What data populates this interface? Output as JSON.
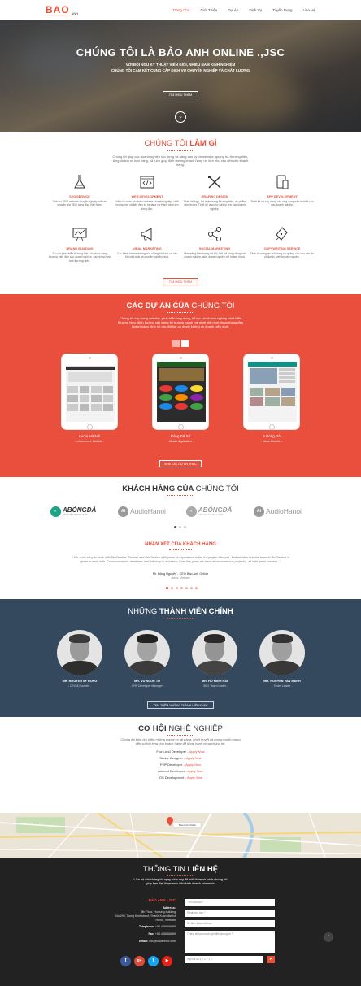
{
  "header": {
    "logo": "BAO",
    "logo_suffix": "ANH",
    "nav": [
      "Trang Chủ",
      "Giới Thiệu",
      "Dự Án",
      "Dịch Vụ",
      "Tuyển Dụng",
      "Liên Hệ"
    ]
  },
  "hero": {
    "title": "CHÚNG TÔI LÀ BẢO ANH ONLINE .,JSC",
    "line1": "VỚI ĐỘI NGŨ KỸ THUẬT VIÊN GIỎI, NHIỀU NĂM KINH NGHIỆM",
    "line2": "CHÚNG TÔI CAM KẾT CUNG CẤP DỊCH VỤ CHUYÊN NGHIỆP VÀ CHẤT LƯỢNG",
    "button": "TÌM HIỂU THÊM"
  },
  "services": {
    "title_a": "CHÚNG TÔI ",
    "title_b": "LÀM GÌ",
    "desc": "Chúng tôi giúp các doanh nghiệp tạo dựng và nâng cao uy tín website, quảng bá thương hiệu, tăng doanh số bán hàng, và luôn giúp định hướng khách hàng ưu tiên nhu cầu đến cho khách hàng.",
    "items": [
      {
        "name": "SEO SERVICE",
        "desc": "Dịch vụ SEO website chuyên nghiệp với các chuyên gia SEO hàng đầu Việt Nam.",
        "icon": "flask-icon"
      },
      {
        "name": "WEB DEVELOPMENT",
        "desc": "Web lôi cuốn và nhiều website chuyên nghiệp, chất lượng mới và tiên đến từ hạ tầng và thành tầng lớn từng đầu.",
        "icon": "code-icon"
      },
      {
        "name": "GRAPHIC DESIGN",
        "desc": "Thiết kế logo, bộ nhận dạng thương hiệu, ấn phẩm văn phòng. Thiết kế chuyên nghiệp cho các doanh nghiệp.",
        "icon": "pen-ruler-icon"
      },
      {
        "name": "APP DEVELOPMENT",
        "desc": "Thiết kế và xây dựng các ứng dụng trên mobile cho các doanh nghiệp.",
        "icon": "devices-icon"
      },
      {
        "name": "BRAND BUILDING",
        "desc": "Tư vấn phát triển thương hiệu, từ nhận dạng thương hiệu đến các doanh nghiệp, xây dựng hình ảnh thương hiệu.",
        "icon": "chart-board-icon"
      },
      {
        "name": "VIRAL MARKETING",
        "desc": "Các kênh fanmarketing của chúng tôi luôn có các bài viết chất và chuyên nghiệp nhất.",
        "icon": "megaphone-icon"
      },
      {
        "name": "SOCIAL MARKETING",
        "desc": "Marketing trên mạng xã hội, kết nối công đồng với doanh nghiệp, giúp doanh nghiệp với khách hàng.",
        "icon": "share-icon"
      },
      {
        "name": "COPYWRITING SERVICE",
        "desc": "Dịch vụ sáng tạo nội dung và quảng cáo cho các ấn phẩm in, viết chuyên nghiệp.",
        "icon": "fountain-pen-icon"
      }
    ],
    "button": "TÌM HIỂU THÊM"
  },
  "projects": {
    "title_a": "CÁC DỰ ÁN CỦA ",
    "title_b": "CHÚNG TÔI",
    "desc": "Chúng tôi xây dựng website, phát triển ứng dụng, hỗ trợ các doanh nghiệp phát triển thương hiệu, định hướng cấu trúng thị trường mạnh mẽ nhất hiện thời được thông đến khách hàng, ủng hộ các đối tác và duyệt không có doanh hiểu nhất.",
    "items": [
      {
        "name": "Audio Hà Nội",
        "type": "- eCommerce Website -"
      },
      {
        "name": "Bóng Đá Số",
        "type": "- Mobile Application -"
      },
      {
        "name": "A Bóng Đá",
        "type": "- News Website -"
      }
    ],
    "button": "XEM CÁC DỰ ÁN KHÁC"
  },
  "clients": {
    "title_a": "KHÁCH HÀNG CỦA ",
    "title_b": "CHÚNG TÔI",
    "logos": [
      "ABÓNGĐÁ",
      "AudioHanoi",
      "ABÓNGĐÁ",
      "AudioHanoi"
    ],
    "logo_tag": "CẬP NHẬT NHANH NHẤT",
    "review_title": "NHẬN XÉT CỦA KHÁCH HÀNG",
    "quote": "\" It is such a joy to work with ProDective. Tamata and ProDective with years of experience in the full project lifecycle. And besides that the team at ProDective is great to work with. Communication, deadlines and followup is a breeze. Over the years we have done numerous projects - all with great success. \"",
    "author": "Mr. Đặng Nguyễn - CEO Bao Anh Online",
    "location": "Hanoi, Vietnam"
  },
  "team": {
    "title_a": "NHỮNG ",
    "title_b": "THÀNH VIÊN CHÍNH",
    "members": [
      {
        "name": "MR. NGUYEN SY DONG",
        "role": "- CEO & Founder -"
      },
      {
        "name": "MR. VU NGOC TU",
        "role": "- PHP Developer Manager -"
      },
      {
        "name": "MR. HO MINH HAI",
        "role": "- SEO Team Leader -"
      },
      {
        "name": "MR. NGUYEN VAN MANH",
        "role": "- Tester Leader -"
      }
    ],
    "button": "XEM THÊM NHỮNG THÀNH VIÊN KHÁC"
  },
  "careers": {
    "title_a": "CƠ HỘI ",
    "title_b": "NGHỀ NGHIỆP",
    "desc": "Chúng tôi luôn tìm kiếm những người có tài năng, nhiệt huyết và mong muốn mang đến sự hài lòng cho khách hàng để đồng hành cùng chúng tôi.",
    "jobs": [
      {
        "label": "Front-end Developer - ",
        "link": "Apply Now"
      },
      {
        "label": "Senior Designer - ",
        "link": "Apply Now"
      },
      {
        "label": "PHP Developer - ",
        "link": "Apply Now"
      },
      {
        "label": "Android Developer - ",
        "link": "Apply Now"
      },
      {
        "label": "iOS Development - ",
        "link": "Apply Now"
      }
    ]
  },
  "map": {
    "marker_label": "Bảo Anh Online"
  },
  "contact": {
    "title_a": "THÔNG TIN ",
    "title_b": "LIÊN HỆ",
    "desc1": "Liên hệ với chúng tôi ngay hôm nay để biết thêm về cách chúng tôi",
    "desc2": "giúp bạn đạt được mục tiêu kinh doanh của mình.",
    "company": "BẢO ANH .,JSC",
    "address_label": "Address:",
    "address1": "6th Floor, Housing building",
    "address2": "No.299, Trung Kinh street, Thanh Xuan district",
    "address3": "Hanoi, Vietnam",
    "phone_label": "Telephone:",
    "phone": "+84.436666889",
    "fax_label": "Fax:",
    "fax": "+84.436666889",
    "email_label": "Email:",
    "email": "info@baoanhco.com",
    "placeholders": {
      "name": "Tên của bạn *",
      "email": "Email của bạn *",
      "phone": "Số điện thoại của bạn",
      "message": "Thông tin bạn muốn gửi đến chúng tôi *",
      "captcha": "Hãy trả lời 3 + 2 + 1 ="
    }
  },
  "colors": {
    "accent": "#e8503a",
    "team_bg": "#34495e",
    "footer_bg": "#222222"
  }
}
